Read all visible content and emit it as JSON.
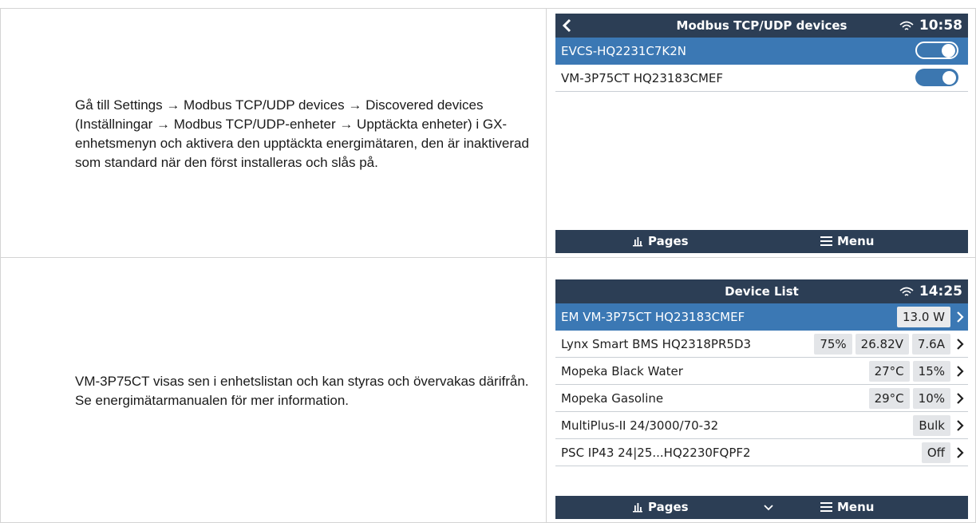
{
  "rows": [
    {
      "text": "Gå till Settings → Modbus TCP/UDP devices → Discovered devices (Inställningar → Modbus TCP/UDP-enheter → Upptäckta enheter) i GX-enhetsmenyn och aktivera den upptäckta energimätaren, den är inaktiverad som standard när den först installeras och slås på.",
      "screen": {
        "title": "Modbus TCP/UDP devices",
        "time": "10:58",
        "items": [
          {
            "label": "EVCS-HQ2231C7K2N",
            "toggle": "on"
          },
          {
            "label": "VM-3P75CT HQ23183CMEF",
            "toggle": "on"
          }
        ],
        "footer": {
          "pages": "Pages",
          "menu": "Menu"
        }
      }
    },
    {
      "text": "VM-3P75CT visas sen i enhetslistan och kan styras och övervakas därifrån. Se energimätarmanualen för mer information.",
      "screen": {
        "title": "Device List",
        "time": "14:25",
        "items": [
          {
            "label": "EM VM-3P75CT HQ23183CMEF",
            "values": [
              "13.0 W"
            ]
          },
          {
            "label": "Lynx Smart BMS HQ2318PR5D3",
            "values": [
              "75%",
              "26.82V",
              "7.6A"
            ]
          },
          {
            "label": "Mopeka Black Water",
            "values": [
              "27°C",
              "15%"
            ]
          },
          {
            "label": "Mopeka Gasoline",
            "values": [
              "29°C",
              "10%"
            ]
          },
          {
            "label": "MultiPlus-II 24/3000/70-32",
            "values": [
              "Bulk"
            ]
          },
          {
            "label": "PSC IP43 24|25...HQ2230FQPF2",
            "values": [
              "Off"
            ]
          }
        ],
        "footer": {
          "pages": "Pages",
          "menu": "Menu"
        }
      }
    }
  ],
  "colors": {
    "header_bg": "#2c3e55",
    "selected_row": "#3b78b4",
    "toggle": "#3c77b0",
    "value_pill": "#e3e5e8"
  },
  "icons": [
    "back-arrow-icon",
    "wifi-icon",
    "bar-chart-icon",
    "hamburger-menu-icon",
    "chevron-down-icon",
    "chevron-right-icon"
  ]
}
